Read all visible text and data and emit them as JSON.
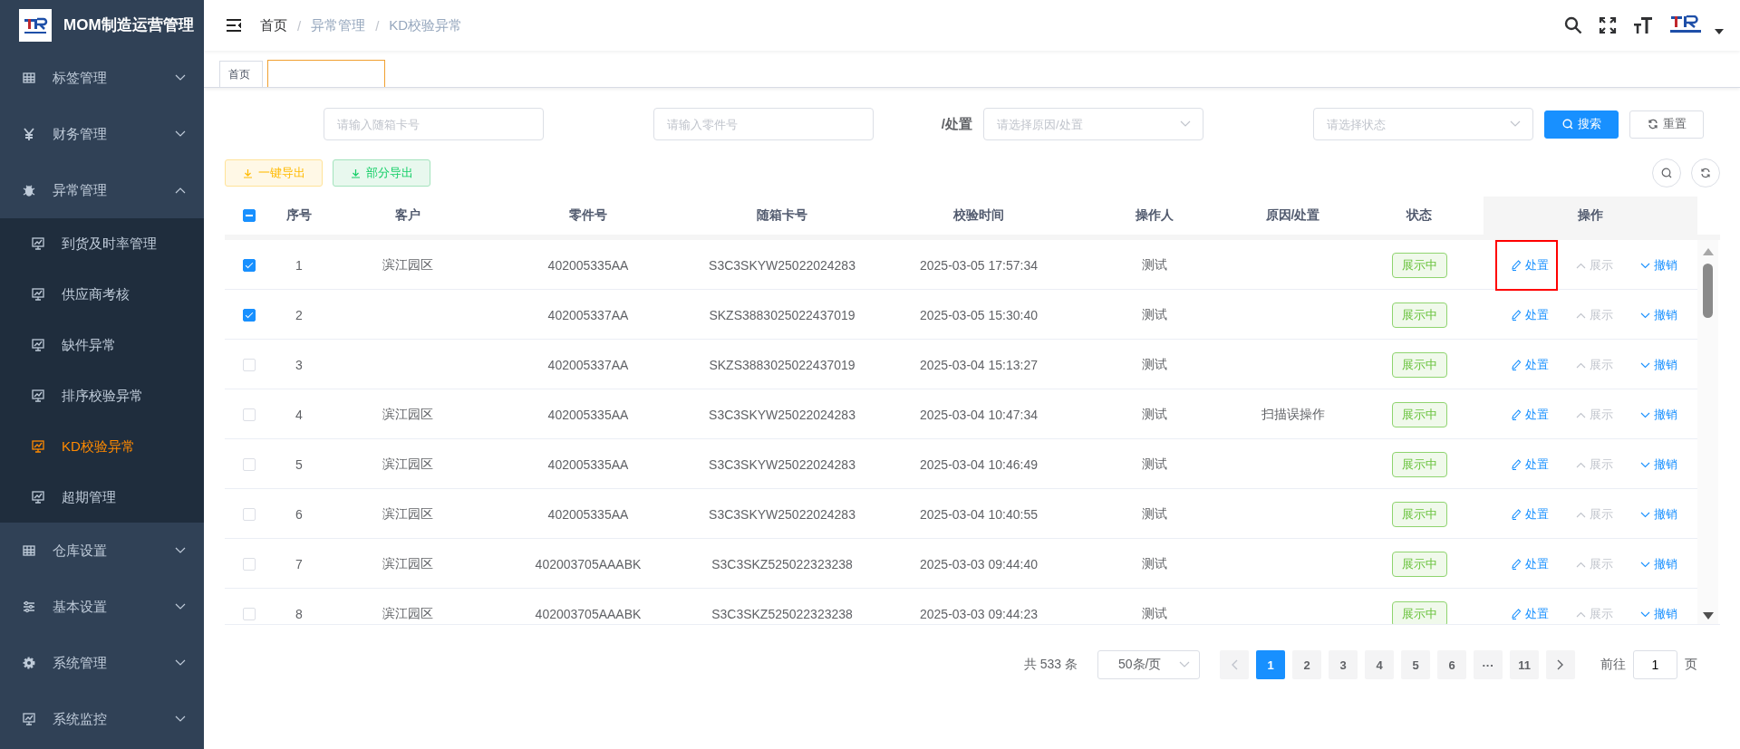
{
  "sidebar": {
    "title": "MOM制造运营管理",
    "menu": [
      {
        "label": "标签管理",
        "kind": "table",
        "expanded": false
      },
      {
        "label": "财务管理",
        "kind": "yen",
        "expanded": false
      },
      {
        "label": "异常管理",
        "kind": "bug",
        "expanded": true,
        "children": [
          {
            "label": "到货及时率管理",
            "selected": false
          },
          {
            "label": "供应商考核",
            "selected": false
          },
          {
            "label": "缺件异常",
            "selected": false
          },
          {
            "label": "排序校验异常",
            "selected": false
          },
          {
            "label": "KD校验异常",
            "selected": true
          },
          {
            "label": "超期管理",
            "selected": false
          }
        ]
      },
      {
        "label": "仓库设置",
        "kind": "table",
        "expanded": false
      },
      {
        "label": "基本设置",
        "kind": "sliders",
        "expanded": false
      },
      {
        "label": "系统管理",
        "kind": "gear",
        "expanded": false
      },
      {
        "label": "系统监控",
        "kind": "monitor",
        "expanded": false
      }
    ]
  },
  "breadcrumb": [
    {
      "label": "首页",
      "link": true
    },
    {
      "separator": "/",
      "label": "异常管理",
      "link": false
    },
    {
      "separator": "/",
      "label": "KD校验异常",
      "link": false
    }
  ],
  "tabs": [
    {
      "label": "首页",
      "selected": false
    },
    {
      "selected": true
    }
  ],
  "filters": [
    {
      "kind": "input",
      "placeholder": "请输入随箱卡号"
    },
    {
      "kind": "input",
      "placeholder": "请输入零件号"
    },
    {
      "kind": "select",
      "label": "/处置",
      "placeholder": "请选择原因/处置"
    },
    {
      "kind": "select",
      "placeholder": "请选择状态"
    }
  ],
  "filter_buttons": [
    {
      "label": "搜索",
      "kind": "primary"
    },
    {
      "label": "重置",
      "kind": "default"
    }
  ],
  "export_buttons": [
    {
      "label": "一键导出",
      "kind": "warning"
    },
    {
      "label": "部分导出",
      "kind": "success"
    }
  ],
  "table": {
    "indeterminate": true,
    "columns": [
      "序号",
      "客户",
      "零件号",
      "随箱卡号",
      "校验时间",
      "操作人",
      "原因/处置",
      "状态",
      "操作"
    ],
    "rows": [
      {
        "checked": true,
        "highlighted": true,
        "index": "1",
        "customer": "滨江园区",
        "part_no": "402005335AA",
        "card_no": "S3C3SKYW25022024283",
        "time": "2025-03-05 17:57:34",
        "operator": "测试",
        "status": "展示中",
        "actions": [
          {
            "label": "处置",
            "kind": "edit",
            "disabled": false
          },
          {
            "label": "展示",
            "kind": "up",
            "disabled": true
          },
          {
            "label": "撤销",
            "kind": "down",
            "disabled": false
          }
        ]
      },
      {
        "checked": true,
        "highlighted": false,
        "index": "2",
        "part_no": "402005337AA",
        "card_no": "SKZS3883025022437019",
        "time": "2025-03-05 15:30:40",
        "operator": "测试",
        "status": "展示中",
        "actions": [
          {
            "label": "处置",
            "kind": "edit",
            "disabled": false
          },
          {
            "label": "展示",
            "kind": "up",
            "disabled": true
          },
          {
            "label": "撤销",
            "kind": "down",
            "disabled": false
          }
        ]
      },
      {
        "checked": false,
        "highlighted": false,
        "index": "3",
        "part_no": "402005337AA",
        "card_no": "SKZS3883025022437019",
        "time": "2025-03-04 15:13:27",
        "operator": "测试",
        "status": "展示中",
        "actions": [
          {
            "label": "处置",
            "kind": "edit",
            "disabled": false
          },
          {
            "label": "展示",
            "kind": "up",
            "disabled": true
          },
          {
            "label": "撤销",
            "kind": "down",
            "disabled": false
          }
        ]
      },
      {
        "checked": false,
        "highlighted": false,
        "index": "4",
        "customer": "滨江园区",
        "part_no": "402005335AA",
        "card_no": "S3C3SKYW25022024283",
        "time": "2025-03-04 10:47:34",
        "operator": "测试",
        "reason": "扫描误操作",
        "status": "展示中",
        "actions": [
          {
            "label": "处置",
            "kind": "edit",
            "disabled": false
          },
          {
            "label": "展示",
            "kind": "up",
            "disabled": true
          },
          {
            "label": "撤销",
            "kind": "down",
            "disabled": false
          }
        ]
      },
      {
        "checked": false,
        "highlighted": false,
        "index": "5",
        "customer": "滨江园区",
        "part_no": "402005335AA",
        "card_no": "S3C3SKYW25022024283",
        "time": "2025-03-04 10:46:49",
        "operator": "测试",
        "status": "展示中",
        "actions": [
          {
            "label": "处置",
            "kind": "edit",
            "disabled": false
          },
          {
            "label": "展示",
            "kind": "up",
            "disabled": true
          },
          {
            "label": "撤销",
            "kind": "down",
            "disabled": false
          }
        ]
      },
      {
        "checked": false,
        "highlighted": false,
        "index": "6",
        "customer": "滨江园区",
        "part_no": "402005335AA",
        "card_no": "S3C3SKYW25022024283",
        "time": "2025-03-04 10:40:55",
        "operator": "测试",
        "status": "展示中",
        "actions": [
          {
            "label": "处置",
            "kind": "edit",
            "disabled": false
          },
          {
            "label": "展示",
            "kind": "up",
            "disabled": true
          },
          {
            "label": "撤销",
            "kind": "down",
            "disabled": false
          }
        ]
      },
      {
        "checked": false,
        "highlighted": false,
        "index": "7",
        "customer": "滨江园区",
        "part_no": "402003705AAABK",
        "card_no": "S3C3SKZ525022323238",
        "time": "2025-03-03 09:44:40",
        "operator": "测试",
        "status": "展示中",
        "actions": [
          {
            "label": "处置",
            "kind": "edit",
            "disabled": false
          },
          {
            "label": "展示",
            "kind": "up",
            "disabled": true
          },
          {
            "label": "撤销",
            "kind": "down",
            "disabled": false
          }
        ]
      },
      {
        "checked": false,
        "highlighted": false,
        "index": "8",
        "customer": "滨江园区",
        "part_no": "402003705AAABK",
        "card_no": "S3C3SKZ525022323238",
        "time": "2025-03-03 09:44:23",
        "operator": "测试",
        "status": "展示中",
        "actions": [
          {
            "label": "处置",
            "kind": "edit",
            "disabled": false
          },
          {
            "label": "展示",
            "kind": "up",
            "disabled": true
          },
          {
            "label": "撤销",
            "kind": "down",
            "disabled": false
          }
        ]
      }
    ]
  },
  "pagination": {
    "total": "共 533 条",
    "page_size": "50条/页",
    "pages": [
      {
        "label": "1",
        "selected": true
      },
      {
        "label": "2",
        "selected": false
      },
      {
        "label": "3",
        "selected": false
      },
      {
        "label": "4",
        "selected": false
      },
      {
        "label": "5",
        "selected": false
      },
      {
        "label": "6",
        "selected": false
      },
      {
        "label": "···",
        "selected": false
      },
      {
        "label": "11",
        "selected": false
      }
    ],
    "goto_label": "前往",
    "goto_value": "1",
    "goto_suffix": "页"
  }
}
